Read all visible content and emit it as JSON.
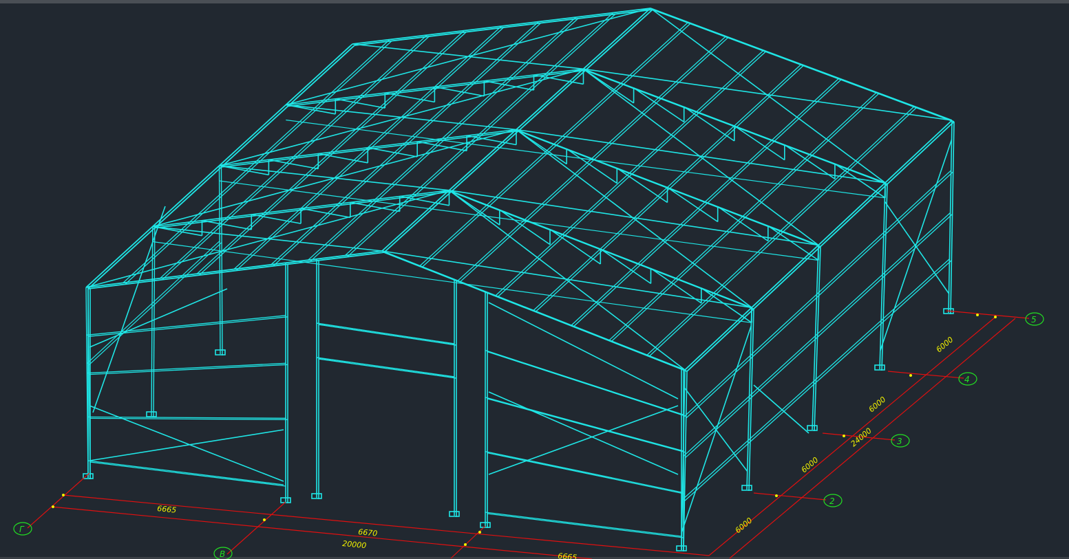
{
  "colors": {
    "background": "#212830",
    "structure": "#1fe6e6",
    "dimension_line": "#e01010",
    "dimension_text": "#f2f200",
    "grid_bubble": "#22e022"
  },
  "dimensions": {
    "front_spans": [
      "6665",
      "6670",
      "6665"
    ],
    "front_total": "20000",
    "side_spans": [
      "6000",
      "6000",
      "6000",
      "6000"
    ],
    "side_total": "24000"
  },
  "grid_axes": {
    "front": [
      "Г",
      "В"
    ],
    "side": [
      "2",
      "3",
      "4",
      "5"
    ]
  }
}
